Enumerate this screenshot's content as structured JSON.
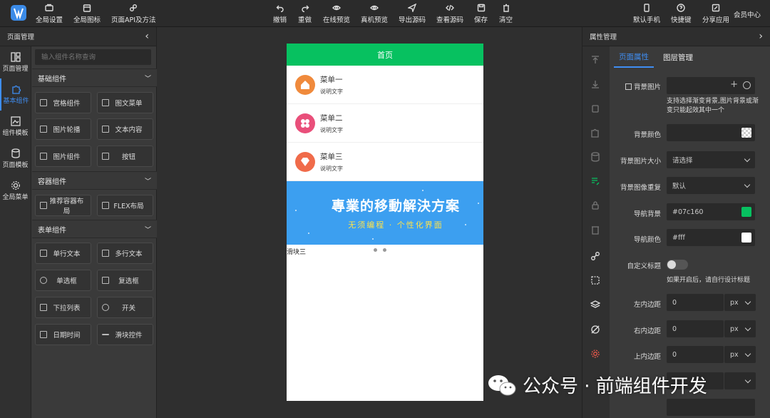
{
  "toolbar": {
    "left": [
      {
        "label": "全局设置",
        "icon": "gear-icon"
      },
      {
        "label": "全局图标",
        "icon": "calendar-icon"
      },
      {
        "label": "页面API及方法",
        "icon": "link-icon"
      }
    ],
    "center": [
      {
        "label": "撤销",
        "icon": "undo-icon"
      },
      {
        "label": "重做",
        "icon": "redo-icon"
      },
      {
        "label": "在线预览",
        "icon": "eye-icon"
      },
      {
        "label": "真机预览",
        "icon": "eye-icon"
      },
      {
        "label": "导出源码",
        "icon": "send-icon"
      },
      {
        "label": "查看源码",
        "icon": "code-icon"
      },
      {
        "label": "保存",
        "icon": "save-icon"
      },
      {
        "label": "清空",
        "icon": "trash-icon"
      }
    ],
    "right": [
      {
        "label": "默认手机",
        "icon": "phone-icon"
      },
      {
        "label": "快捷键",
        "icon": "question-icon"
      },
      {
        "label": "分享应用",
        "icon": "share-icon"
      },
      {
        "label": "会员中心",
        "icon": ""
      }
    ]
  },
  "left_panel": {
    "title": "页面管理",
    "nav": [
      "页面管理",
      "基本组件",
      "组件模板",
      "页面模板",
      "全局菜单"
    ],
    "search_placeholder": "输入组件名称查询",
    "sections": [
      {
        "title": "基础组件",
        "items": [
          "宫格组件",
          "图文菜单",
          "图片轮播",
          "文本内容",
          "图片组件",
          "按钮"
        ]
      },
      {
        "title": "容器组件",
        "items": [
          "推荐容器布局",
          "FLEX布局"
        ]
      },
      {
        "title": "表单组件",
        "items": [
          "单行文本",
          "多行文本",
          "单选框",
          "复选框",
          "下拉列表",
          "开关",
          "日期时间",
          "滑块控件"
        ]
      }
    ]
  },
  "phone": {
    "nav_title": "首页",
    "nav_color": "#07c160",
    "menus": [
      {
        "title": "菜单一",
        "sub": "说明文字",
        "color": "#f08a3c",
        "icon": "home-icon"
      },
      {
        "title": "菜单二",
        "sub": "说明文字",
        "color": "#e94f7a",
        "icon": "flower-icon"
      },
      {
        "title": "菜单三",
        "sub": "说明文字",
        "color": "#f06b4a",
        "icon": "diamond-icon"
      }
    ],
    "banner_title": "專業的移動解決方案",
    "banner_sub": "无须编程 · 个性化界面",
    "slide_caption": "滑块三"
  },
  "right_panel": {
    "title": "属性管理",
    "tabs": [
      "页面属性",
      "图层管理"
    ],
    "props": {
      "bg_image_label": "背景图片",
      "bg_note": "支持选择渐变背景,图片背景或渐变只能起效其中一个",
      "bg_color_label": "背景颜色",
      "bg_size_label": "背景图片大小",
      "bg_size_value": "请选择",
      "bg_repeat_label": "背景图像重复",
      "bg_repeat_value": "默认",
      "nav_bg_label": "导航背景",
      "nav_bg_value": "#07c160",
      "nav_color_label": "导航颜色",
      "nav_color_value": "#fff",
      "custom_title_label": "自定义标题",
      "custom_title_note": "如果开启后，请自行设计标题",
      "pad_left_label": "左内边距",
      "pad_right_label": "右内边距",
      "pad_top_label": "上内边距",
      "pad_value": "0",
      "pad_unit": "px"
    }
  },
  "watermark": "公众号 · 前端组件开发"
}
